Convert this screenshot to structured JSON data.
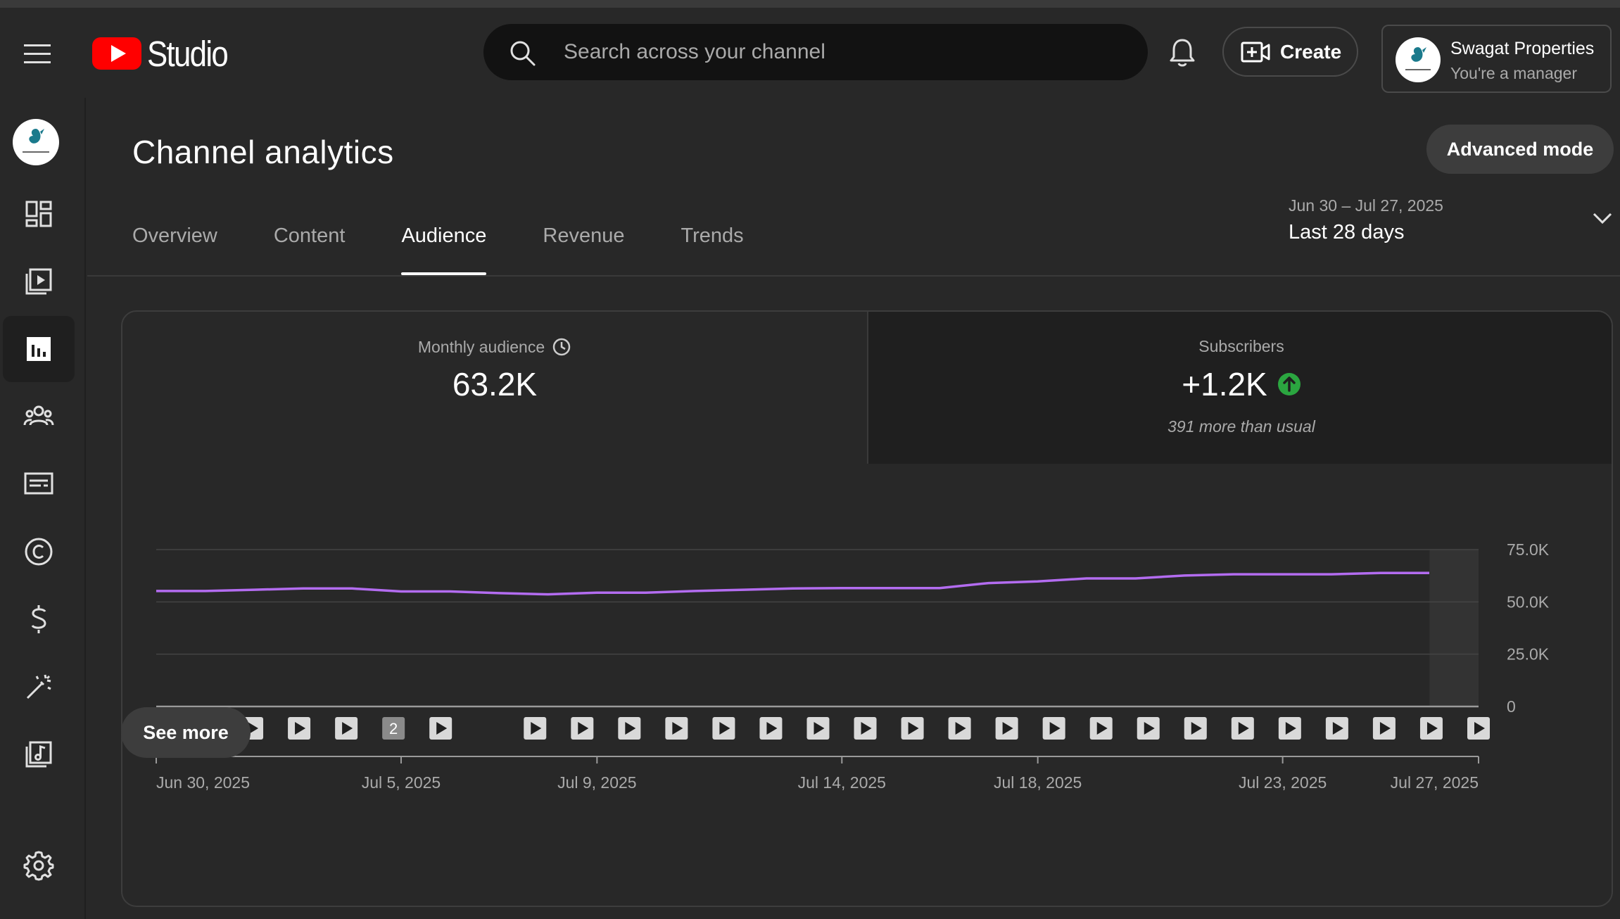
{
  "header": {
    "logo_text": "Studio",
    "search_placeholder": "Search across your channel",
    "create_label": "Create",
    "account_name": "Swagat Properties",
    "account_role": "You're a manager"
  },
  "sidebar": {
    "items": [
      "dashboard",
      "content",
      "analytics",
      "community",
      "subtitles",
      "copyright",
      "earn",
      "customization",
      "audio-library",
      "settings"
    ],
    "active": "analytics"
  },
  "page": {
    "title": "Channel analytics",
    "advanced_label": "Advanced mode",
    "tabs": [
      "Overview",
      "Content",
      "Audience",
      "Revenue",
      "Trends"
    ],
    "active_tab": "Audience",
    "date_range": "Jun 30 – Jul 27, 2025",
    "period": "Last 28 days"
  },
  "metrics": {
    "monthly_audience_label": "Monthly audience",
    "monthly_audience_value": "63.2K",
    "subscribers_label": "Subscribers",
    "subscribers_value": "+1.2K",
    "subscribers_note": "391 more than usual"
  },
  "see_more_label": "See more",
  "colors": {
    "line": "#b36cf0",
    "up_badge": "#2ba640",
    "brand_red": "#ff0000"
  },
  "chart_data": {
    "type": "line",
    "series": [
      {
        "values": [
          55200,
          55200,
          55800,
          56400,
          56400,
          55000,
          55000,
          54200,
          53600,
          54400,
          54400,
          55200,
          55800,
          56400,
          56600,
          56600,
          56600,
          59000,
          59800,
          61200,
          61200,
          62600,
          63200,
          63200,
          63200,
          63800,
          63800
        ]
      }
    ],
    "x_range": [
      "Jun 30, 2025",
      "Jul 27, 2025"
    ],
    "x_tick_labels": [
      "Jun 30, 2025",
      "Jul 5, 2025",
      "Jul 9, 2025",
      "Jul 14, 2025",
      "Jul 18, 2025",
      "Jul 23, 2025",
      "Jul 27, 2025"
    ],
    "y_tick_labels": [
      "0",
      "25.0K",
      "50.0K",
      "75.0K"
    ],
    "ylim": [
      0,
      75000
    ],
    "grid": true,
    "upload_markers": [
      "play",
      "play",
      "play",
      "play",
      "2",
      "play",
      "",
      "play",
      "play",
      "play",
      "play",
      "play",
      "play",
      "play",
      "play",
      "play",
      "play",
      "play",
      "play",
      "play",
      "play",
      "play",
      "play",
      "play",
      "play",
      "play",
      "play",
      "play"
    ],
    "grouped_marker_label": "2"
  }
}
